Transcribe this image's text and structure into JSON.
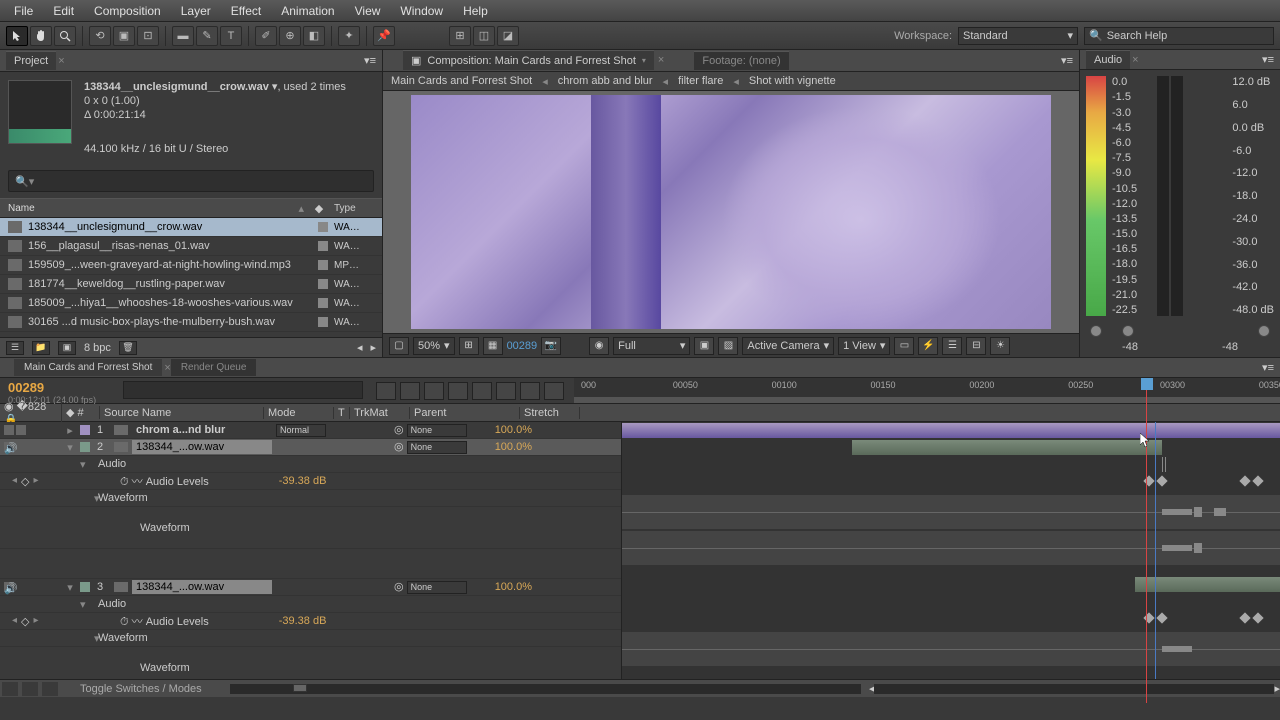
{
  "menu": {
    "items": [
      "File",
      "Edit",
      "Composition",
      "Layer",
      "Effect",
      "Animation",
      "View",
      "Window",
      "Help"
    ]
  },
  "workspace": {
    "label": "Workspace:",
    "value": "Standard"
  },
  "search": {
    "placeholder": "Search Help"
  },
  "project": {
    "tab": "Project",
    "selected_file": "138344__unclesigmund__crow.wav",
    "used": ", used 2 times",
    "dims": "0 x 0 (1.00)",
    "duration": "Δ 0:00:21:14",
    "format": "44.100 kHz / 16 bit U / Stereo",
    "col_name": "Name",
    "col_type": "Type",
    "items": [
      {
        "name": "138344__unclesigmund__crow.wav",
        "type": "WA…",
        "selected": true
      },
      {
        "name": "156__plagasul__risas-nenas_01.wav",
        "type": "WA…"
      },
      {
        "name": "159509_...ween-graveyard-at-night-howling-wind.mp3",
        "type": "MP…"
      },
      {
        "name": "181774__keweldog__rustling-paper.wav",
        "type": "WA…"
      },
      {
        "name": "185009_...hiya1__whooshes-18-wooshes-various.wav",
        "type": "WA…"
      },
      {
        "name": "30165   ...d   music-box-plays-the-mulberry-bush.wav",
        "type": "WA…"
      }
    ],
    "bpc": "8 bpc"
  },
  "composition": {
    "tab_prefix": "Composition: ",
    "tab_name": "Main Cards and Forrest Shot",
    "footage_tab": "Footage: (none)",
    "breadcrumbs": [
      "Main Cards and Forrest Shot",
      "chrom abb and blur",
      "filter flare",
      "Shot with vignette"
    ],
    "zoom": "50%",
    "time": "00289",
    "res": "Full",
    "camera": "Active Camera",
    "view": "1 View"
  },
  "audio": {
    "tab": "Audio",
    "scale_left": [
      "0.0",
      "-1.5",
      "-3.0",
      "-4.5",
      "-6.0",
      "-7.5",
      "-9.0",
      "-10.5",
      "-12.0",
      "-13.5",
      "-15.0",
      "-16.5",
      "-18.0",
      "-19.5",
      "-21.0",
      "-22.5"
    ],
    "scale_right": [
      "12.0 dB",
      "6.0",
      "0.0 dB",
      "-6.0",
      "-12.0",
      "-18.0",
      "-24.0",
      "-30.0",
      "-36.0",
      "-42.0",
      "-48.0 dB"
    ],
    "readout_l": "-48",
    "readout_r": "-48"
  },
  "timeline": {
    "tab_active": "Main Cards and Forrest Shot",
    "tab_render": "Render Queue",
    "frames": "00289",
    "timecode": "0:00:12:01 (24.00 fps)",
    "ruler": [
      "000",
      "00050",
      "00100",
      "00150",
      "00200",
      "00250",
      "00300",
      "00350"
    ],
    "col_num": "#",
    "col_source": "Source Name",
    "col_mode": "Mode",
    "col_t": "T",
    "col_trkmat": "TrkMat",
    "col_parent": "Parent",
    "col_stretch": "Stretch",
    "layers": [
      {
        "num": "1",
        "name": "chrom a...nd blur",
        "mode": "Normal",
        "parent": "None",
        "stretch": "100.0%",
        "type": "comp"
      },
      {
        "num": "2",
        "name": "138344_...ow.wav",
        "parent": "None",
        "stretch": "100.0%",
        "boxed": true
      }
    ],
    "audio_group": "Audio",
    "audio_levels": "Audio Levels",
    "audio_val": "-39.38 dB",
    "waveform": "Waveform",
    "layer3": {
      "num": "3",
      "name": "138344_...ow.wav",
      "parent": "None",
      "stretch": "100.0%"
    },
    "parent_none": "None",
    "mode_normal": "Normal",
    "footer_toggle": "Toggle Switches / Modes"
  }
}
